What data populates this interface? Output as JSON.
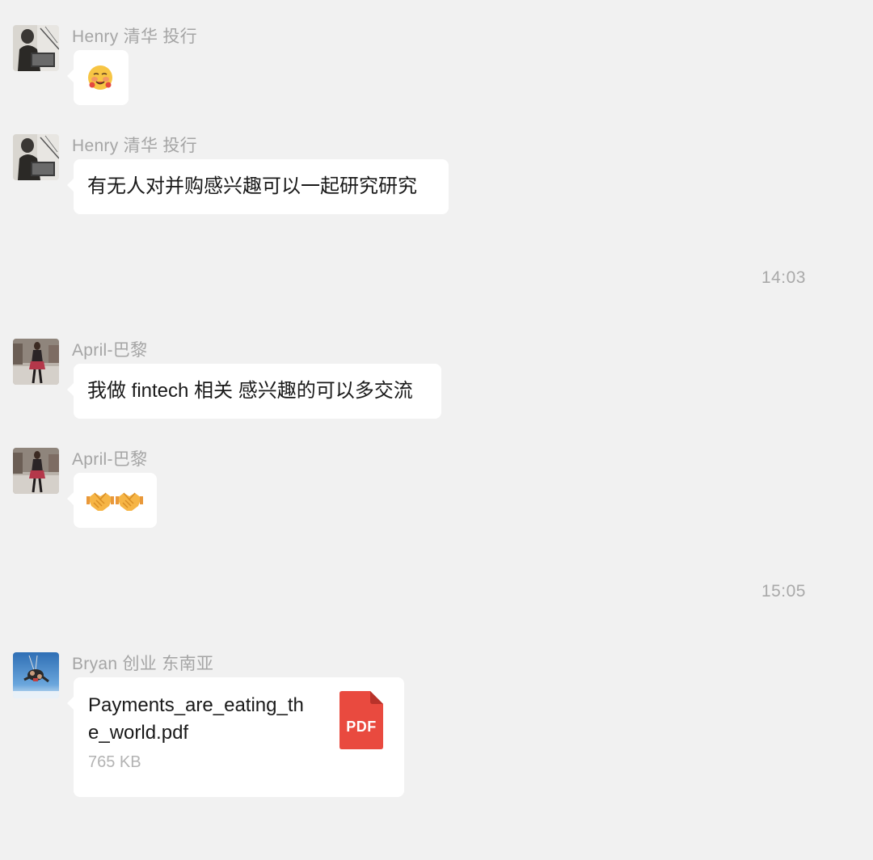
{
  "messages": [
    {
      "sender": "Henry 清华 投行",
      "avatar": "henry-avatar",
      "type": "emoji",
      "emoji": "🥰"
    },
    {
      "sender": "Henry 清华 投行",
      "avatar": "henry-avatar",
      "type": "text",
      "text": "有无人对并购感兴趣可以一起研究研究"
    },
    {
      "sender": "April-巴黎",
      "avatar": "april-avatar",
      "type": "text",
      "text": "我做 fintech 相关 感兴趣的可以多交流"
    },
    {
      "sender": "April-巴黎",
      "avatar": "april-avatar",
      "type": "emoji",
      "emoji": "🤝🤝"
    },
    {
      "sender": "Bryan 创业 东南亚",
      "avatar": "bryan-avatar",
      "type": "file",
      "file": {
        "name": "Payments_are_eating_the_world.pdf",
        "size": "765 KB",
        "icon_label": "PDF"
      }
    }
  ],
  "timestamps": [
    "14:03",
    "15:05"
  ],
  "colors": {
    "background": "#f1f1f1",
    "bubble": "#ffffff",
    "sender_text": "#a5a5a5",
    "timestamp_text": "#a9a9a9",
    "pdf_red": "#e94a3f"
  }
}
